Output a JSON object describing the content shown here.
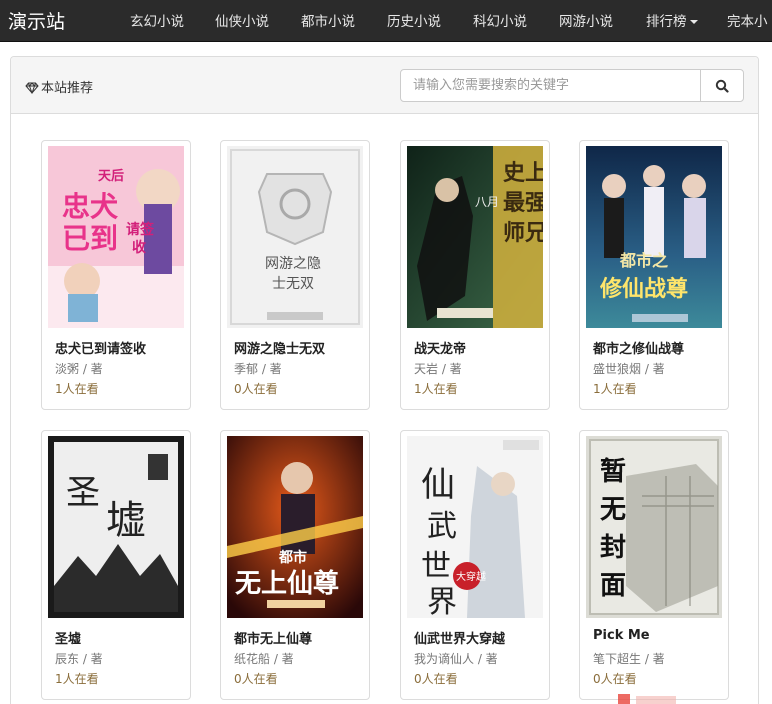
{
  "navbar": {
    "brand": "演示站",
    "items": [
      {
        "label": "玄幻小说"
      },
      {
        "label": "仙侠小说"
      },
      {
        "label": "都市小说"
      },
      {
        "label": "历史小说"
      },
      {
        "label": "科幻小说"
      },
      {
        "label": "网游小说"
      },
      {
        "label": "排行榜"
      },
      {
        "label": "完本小"
      }
    ]
  },
  "panel": {
    "title": "本站推荐",
    "title_icon": "diamond-icon",
    "search": {
      "placeholder": "请输入您需要搜索的关键字",
      "value": "",
      "button_icon": "search-icon"
    }
  },
  "books": [
    {
      "title": "忠犬已到请签收",
      "author": "淡粥 / 著",
      "readers": "1人在看",
      "cover_text": "忠犬已到请签收",
      "cover_colors": [
        "#f7c7d8",
        "#f2f2f2"
      ]
    },
    {
      "title": "网游之隐士无双",
      "author": "季郁 / 著",
      "readers": "0人在看",
      "cover_text": "网游之隐士无双",
      "cover_colors": [
        "#f1f1f1",
        "#e4e4e4"
      ]
    },
    {
      "title": "战天龙帝",
      "author": "天岩 / 著",
      "readers": "1人在看",
      "cover_text": "史上最强师兄",
      "cover_colors": [
        "#1f3d2c",
        "#c9a63a"
      ]
    },
    {
      "title": "都市之修仙战尊",
      "author": "盛世狼烟 / 著",
      "readers": "1人在看",
      "cover_text": "都市之修仙战尊",
      "cover_colors": [
        "#1d3c6a",
        "#2f7a8a"
      ]
    },
    {
      "title": "圣墟",
      "author": "辰东 / 著",
      "readers": "1人在看",
      "cover_text": "圣墟",
      "cover_colors": [
        "#1a1a1a",
        "#eeeeee"
      ]
    },
    {
      "title": "都市无上仙尊",
      "author": "纸花船 / 著",
      "readers": "0人在看",
      "cover_text": "都市无上仙尊",
      "cover_colors": [
        "#3a1010",
        "#d9481a"
      ]
    },
    {
      "title": "仙武世界大穿越",
      "author": "我为谪仙人 / 著",
      "readers": "0人在看",
      "cover_text": "仙武世界",
      "cover_colors": [
        "#f4f4f4",
        "#9aa3ad"
      ]
    },
    {
      "title": "Pick Me",
      "author": "笔下超生 / 著",
      "readers": "0人在看",
      "cover_text": "暂无封面",
      "cover_colors": [
        "#e7e7e1",
        "#8c8c80"
      ]
    }
  ]
}
